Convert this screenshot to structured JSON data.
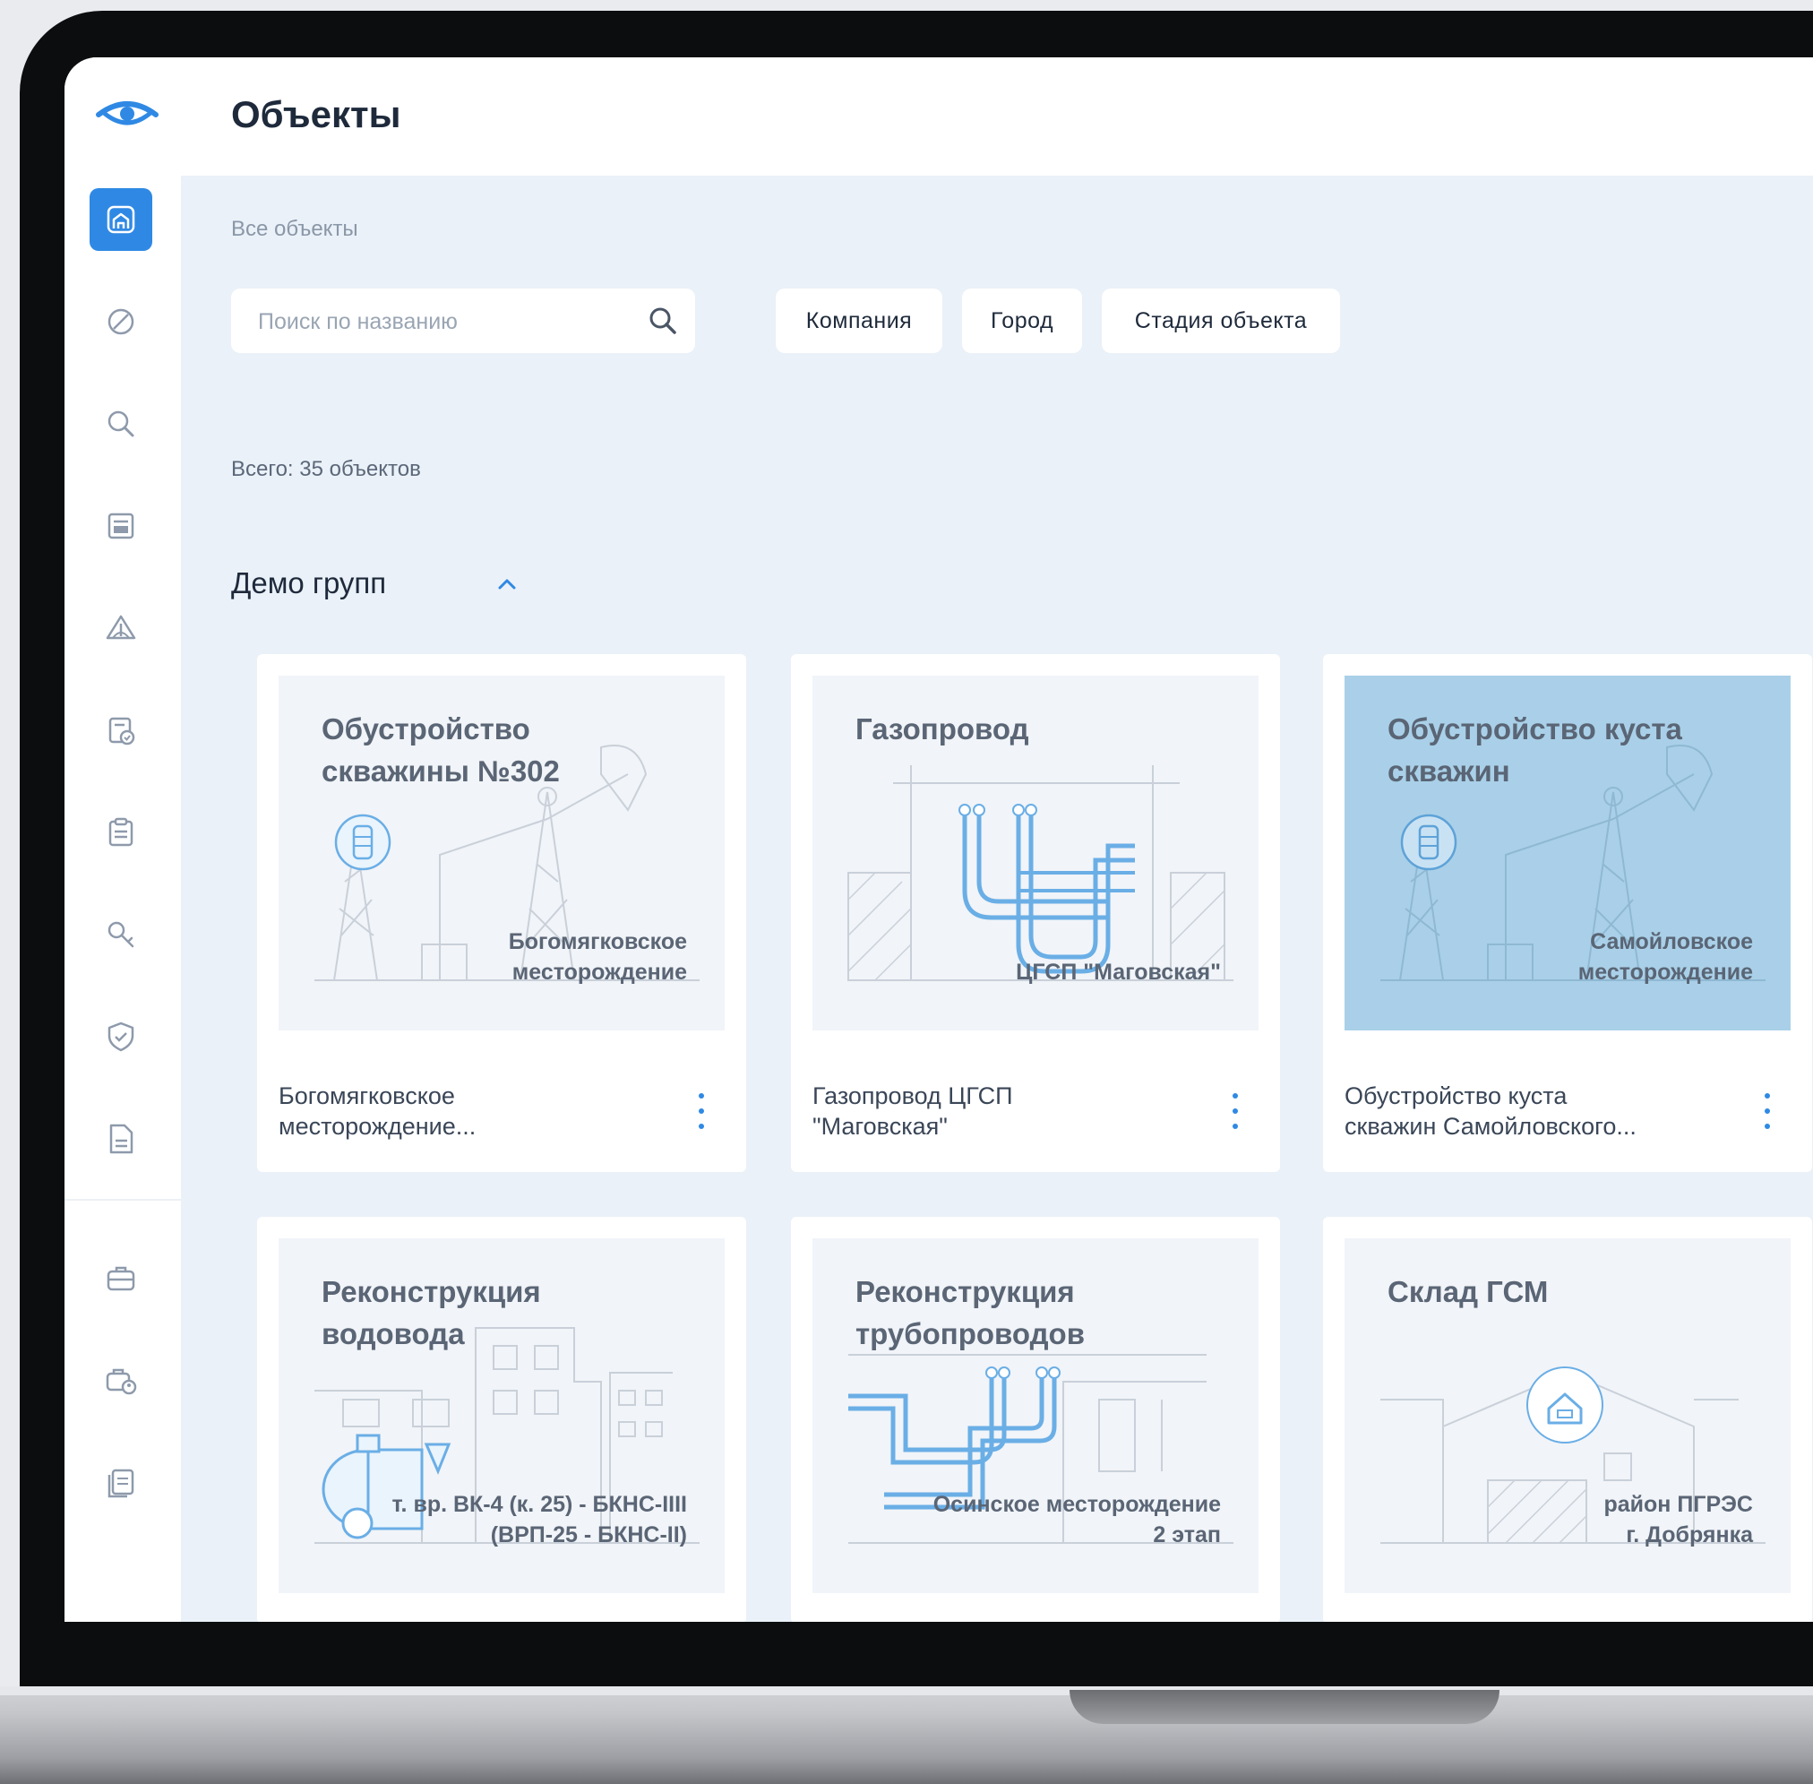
{
  "app": {
    "title": "Объекты"
  },
  "breadcrumb": "Все объекты",
  "search": {
    "placeholder": "Поиск по названию",
    "value": ""
  },
  "filters": [
    "Компания",
    "Город",
    "Стадия объекта"
  ],
  "total": "Всего: 35 объектов",
  "group": {
    "name": "Демо групп",
    "expanded": true
  },
  "sidebar": {
    "items": [
      {
        "icon": "objects-home-icon",
        "active": true
      },
      {
        "icon": "prohibited-icon"
      },
      {
        "icon": "search-icon"
      },
      {
        "icon": "document-list-icon"
      },
      {
        "icon": "warning-icon"
      },
      {
        "icon": "clipboard-check-icon"
      },
      {
        "icon": "clipboard-icon"
      },
      {
        "icon": "key-icon"
      },
      {
        "icon": "shield-check-icon"
      },
      {
        "icon": "file-icon"
      },
      {
        "icon": "briefcase-icon"
      },
      {
        "icon": "briefcase-user-icon"
      },
      {
        "icon": "files-icon"
      }
    ]
  },
  "cards": [
    {
      "thumb_title": "Обустройство\nскважины №302",
      "thumb_caption": "Богомягковское\nместорождение",
      "name": "Богомягковское\nместорождение...",
      "art": "pumpjack",
      "highlighted": false
    },
    {
      "thumb_title": "Газопровод",
      "thumb_caption": "ЦГСП \"Маговская\"",
      "name": "Газопровод ЦГСП\n\"Маговская\"",
      "art": "pipeline",
      "highlighted": false
    },
    {
      "thumb_title": "Обустройство куста\nскважин",
      "thumb_caption": "Самойловское\nместорождение",
      "name": "Обустройство куста\nскважин Самойловского...",
      "art": "pumpjack",
      "highlighted": true
    },
    {
      "thumb_title": "Реконструкция\nводовода",
      "thumb_caption": "т. вр. ВК-4 (к. 25) - БКНС-IIII\n(ВРП-25 - БКНС-II)",
      "name": "",
      "art": "water",
      "highlighted": false
    },
    {
      "thumb_title": "Реконструкция\nтрубопроводов",
      "thumb_caption": "Осинское месторождение\n2 этап",
      "name": "",
      "art": "pipes2",
      "highlighted": false
    },
    {
      "thumb_title": "Склад ГСМ",
      "thumb_caption": "район ПГРЭС\nг. Добрянка",
      "name": "",
      "art": "warehouse",
      "highlighted": false
    }
  ],
  "colors": {
    "accent": "#2f89e4",
    "background": "#eaf1f8",
    "thumb_highlight": "#a9d0e8"
  }
}
